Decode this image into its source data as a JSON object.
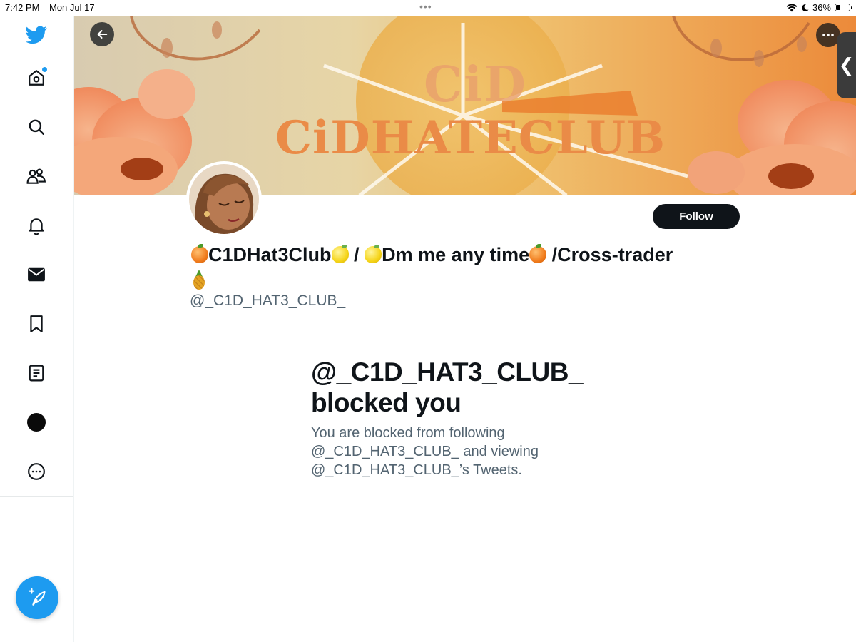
{
  "status_bar": {
    "time": "7:42 PM",
    "date": "Mon Jul 17",
    "battery_percent": "36%",
    "battery_level": 0.36
  },
  "sidebar": {
    "items": [
      {
        "icon": "twitter-bird-icon"
      },
      {
        "icon": "home-icon",
        "has_notification_dot": true
      },
      {
        "icon": "search-icon"
      },
      {
        "icon": "communities-icon"
      },
      {
        "icon": "bell-icon"
      },
      {
        "icon": "mail-icon"
      },
      {
        "icon": "bookmark-icon"
      },
      {
        "icon": "lists-icon"
      },
      {
        "icon": "profile-avatar-icon"
      },
      {
        "icon": "more-circle-icon"
      }
    ],
    "compose_icon": "compose-feather-icon"
  },
  "banner": {
    "text_small": "CiD",
    "text_big": "CiDHATECLUB"
  },
  "profile": {
    "name_parts": [
      "C1DHat3Club",
      "/",
      "Dm me any time",
      "/Cross-trader"
    ],
    "handle": "@_C1D_HAT3_CLUB_",
    "follow_label": "Follow"
  },
  "blocked": {
    "title_line1": "@_C1D_HAT3_CLUB_",
    "title_line2": "blocked you",
    "message_line1": "You are blocked from following",
    "message_line2": "@_C1D_HAT3_CLUB_ and viewing",
    "message_line3": "@_C1D_HAT3_CLUB_’s Tweets."
  },
  "colors": {
    "accent": "#1d9bf0",
    "text_primary": "#0f1419",
    "text_secondary": "#536471",
    "banner_orange": "#ea8b47"
  }
}
